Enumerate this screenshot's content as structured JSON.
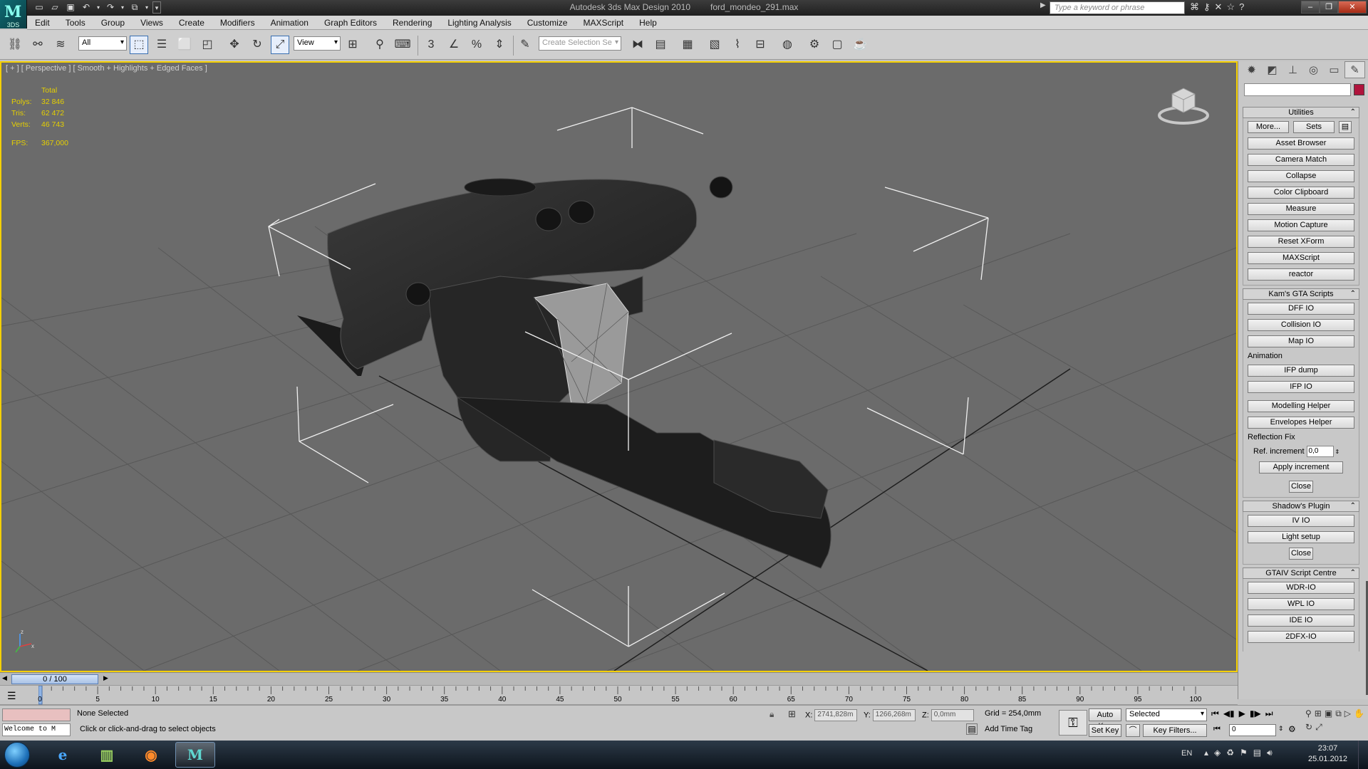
{
  "window": {
    "app_title": "Autodesk 3ds Max Design 2010",
    "file_name": "ford_mondeo_291.max",
    "search_placeholder": "Type a keyword or phrase",
    "logo_text": "3DS"
  },
  "quick_access": [
    "new-icon",
    "open-icon",
    "save-icon",
    "undo-icon",
    "redo-icon",
    "project-icon"
  ],
  "menu": [
    "Edit",
    "Tools",
    "Group",
    "Views",
    "Create",
    "Modifiers",
    "Animation",
    "Graph Editors",
    "Rendering",
    "Lighting Analysis",
    "Customize",
    "MAXScript",
    "Help"
  ],
  "toolbar": {
    "selection_filter": "All",
    "ref_coord": "View",
    "named_selection_placeholder": "Create Selection Se",
    "snap_number": "3"
  },
  "viewport": {
    "label": "[ + ] [ Perspective ] [ Smooth + Highlights + Edged Faces ]",
    "stats": {
      "header": "Total",
      "rows": [
        {
          "key": "Polys:",
          "value": "32 846"
        },
        {
          "key": "Tris:",
          "value": "62 472"
        },
        {
          "key": "Verts:",
          "value": "46 743"
        }
      ],
      "fps_key": "FPS:",
      "fps_value": "367,000"
    },
    "colors": {
      "background": "#6b6b6b",
      "border": "#f5d000",
      "stats": "#e6d000",
      "grid": "#585858"
    }
  },
  "command_panel": {
    "tabs": [
      "create-icon",
      "modify-icon",
      "hierarchy-icon",
      "motion-icon",
      "display-icon",
      "utilities-icon"
    ],
    "utilities": {
      "title": "Utilities",
      "more_label": "More...",
      "sets_label": "Sets",
      "buttons": [
        "Asset Browser",
        "Camera Match",
        "Collapse",
        "Color Clipboard",
        "Measure",
        "Motion Capture",
        "Reset XForm",
        "MAXScript",
        "reactor"
      ]
    },
    "kams": {
      "title": "Kam's GTA Scripts",
      "buttons_top": [
        "DFF IO",
        "Collision IO",
        "Map IO"
      ],
      "animation_label": "Animation",
      "buttons_anim": [
        "IFP dump",
        "IFP IO"
      ],
      "buttons_helpers": [
        "Modelling Helper",
        "Envelopes Helper"
      ],
      "reflection_label": "Reflection Fix",
      "ref_increment_label": "Ref. increment",
      "ref_increment_value": "0,0",
      "apply_label": "Apply increment",
      "close_label": "Close"
    },
    "shadow": {
      "title": "Shadow's Plugin",
      "buttons": [
        "IV IO",
        "Light setup"
      ],
      "close_label": "Close"
    },
    "gtaiv": {
      "title": "GTAIV Script Centre",
      "buttons": [
        "WDR-IO",
        "WPL IO",
        "IDE IO",
        "2DFX-IO"
      ]
    }
  },
  "timeline": {
    "slider_label": "0 / 100",
    "ticks": [
      "0",
      "5",
      "10",
      "15",
      "20",
      "25",
      "30",
      "35",
      "40",
      "45",
      "50",
      "55",
      "60",
      "65",
      "70",
      "75",
      "80",
      "85",
      "90",
      "95",
      "100"
    ]
  },
  "status": {
    "listener_text": "Welcome to M",
    "selection": "None Selected",
    "prompt": "Click or click-and-drag to select objects",
    "x_label": "X:",
    "x_value": "2741,828m",
    "y_label": "Y:",
    "y_value": "1266,268m",
    "z_label": "Z:",
    "z_value": "0,0mm",
    "grid": "Grid = 254,0mm",
    "add_time_tag": "Add Time Tag",
    "auto_key": "Auto Key",
    "set_key": "Set Key",
    "key_mode": "Selected",
    "key_filters": "Key Filters...",
    "frame": "0"
  },
  "taskbar": {
    "apps": [
      "internet-explorer-icon",
      "file-manager-icon",
      "firefox-icon",
      "3dsmax-icon"
    ],
    "lang": "EN",
    "time": "23:07",
    "date": "25.01.2012"
  }
}
